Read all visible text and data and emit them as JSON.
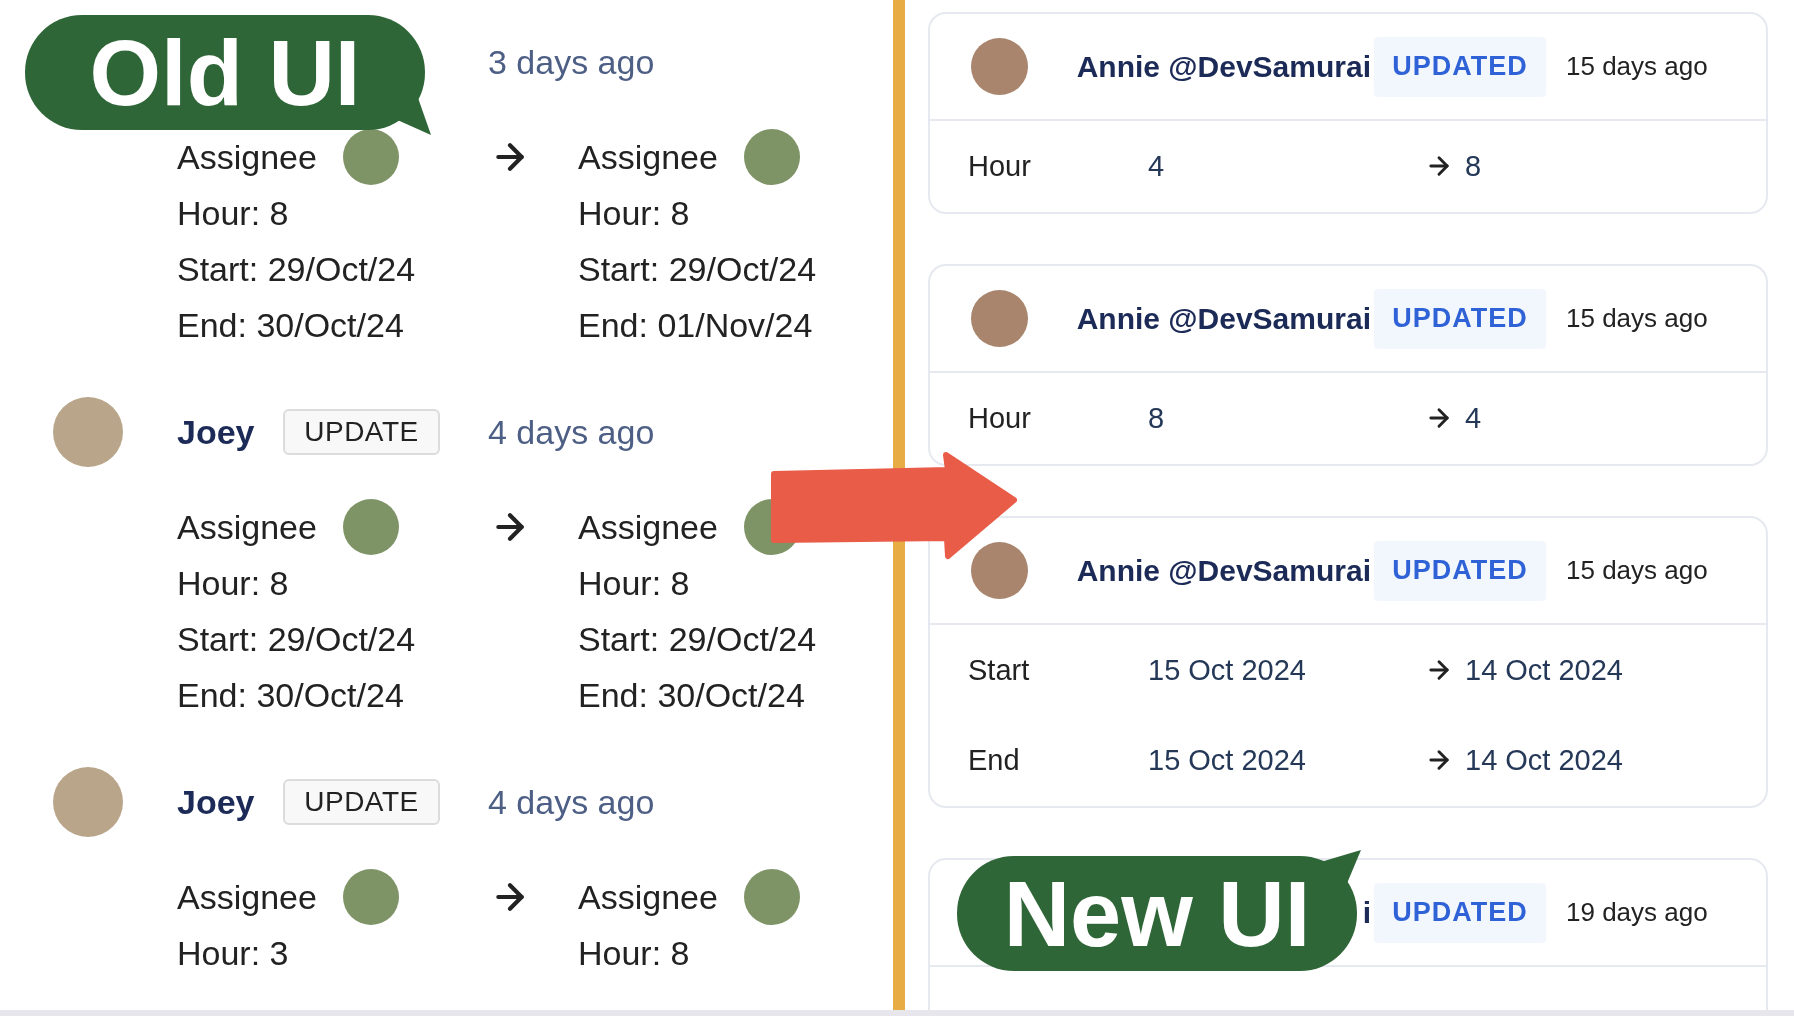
{
  "old_ui": {
    "label": "Old UI",
    "entries": [
      {
        "time": "3 days ago",
        "rows": [
          {
            "kind": "assignee",
            "before": "Assignee",
            "after": "Assignee"
          },
          {
            "kind": "text",
            "before": "Hour: 8",
            "after": "Hour: 8"
          },
          {
            "kind": "text",
            "before": "Start: 29/Oct/24",
            "after": "Start: 29/Oct/24"
          },
          {
            "kind": "text",
            "before": "End: 30/Oct/24",
            "after": "End: 01/Nov/24"
          }
        ]
      },
      {
        "user": "Joey",
        "badge": "UPDATE",
        "time": "4 days ago",
        "rows": [
          {
            "kind": "assignee",
            "before": "Assignee",
            "after": "Assignee"
          },
          {
            "kind": "text",
            "before": "Hour: 8",
            "after": "Hour: 8"
          },
          {
            "kind": "text",
            "before": "Start: 29/Oct/24",
            "after": "Start: 29/Oct/24"
          },
          {
            "kind": "text",
            "before": "End: 30/Oct/24",
            "after": "End: 30/Oct/24"
          }
        ]
      },
      {
        "user": "Joey",
        "badge": "UPDATE",
        "time": "4 days ago",
        "rows": [
          {
            "kind": "assignee",
            "before": "Assignee",
            "after": "Assignee"
          },
          {
            "kind": "text",
            "before": "Hour: 3",
            "after": "Hour: 8"
          }
        ]
      }
    ]
  },
  "new_ui": {
    "label": "New UI",
    "cards": [
      {
        "avatar": true,
        "user": "Annie @DevSamurai",
        "badge": "UPDATED",
        "time": "15 days ago",
        "rows": [
          {
            "label": "Hour",
            "before": "4",
            "after": "8"
          }
        ]
      },
      {
        "avatar": true,
        "user": "Annie @DevSamurai",
        "badge": "UPDATED",
        "time": "15 days ago",
        "rows": [
          {
            "label": "Hour",
            "before": "8",
            "after": "4"
          }
        ]
      },
      {
        "avatar": true,
        "user": "Annie @DevSamurai",
        "badge": "UPDATED",
        "time": "15 days ago",
        "rows": [
          {
            "label": "Start",
            "before": "15 Oct 2024",
            "after": "14 Oct 2024"
          },
          {
            "label": "End",
            "before": "15 Oct 2024",
            "after": "14 Oct 2024"
          }
        ]
      },
      {
        "avatar": false,
        "user": "i",
        "badge": "UPDATED",
        "time": "19 days ago"
      }
    ]
  }
}
